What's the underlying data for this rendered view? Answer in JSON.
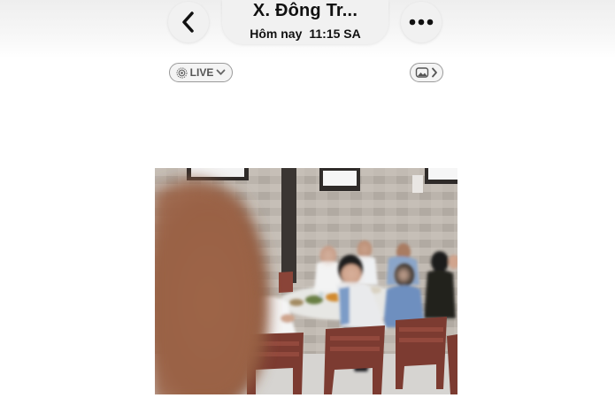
{
  "header": {
    "title": "X. Đông Tr...",
    "date_label": "Hôm nay",
    "time_label": "11:15 SA",
    "back_icon": "chevron-left-icon",
    "more_icon": "ellipsis-icon"
  },
  "badges": {
    "live_label": "LIVE",
    "live_icon": "live-photo-icon",
    "visibility_icon": "album-icon"
  },
  "photo": {
    "kind": "blurred group dining photo"
  }
}
